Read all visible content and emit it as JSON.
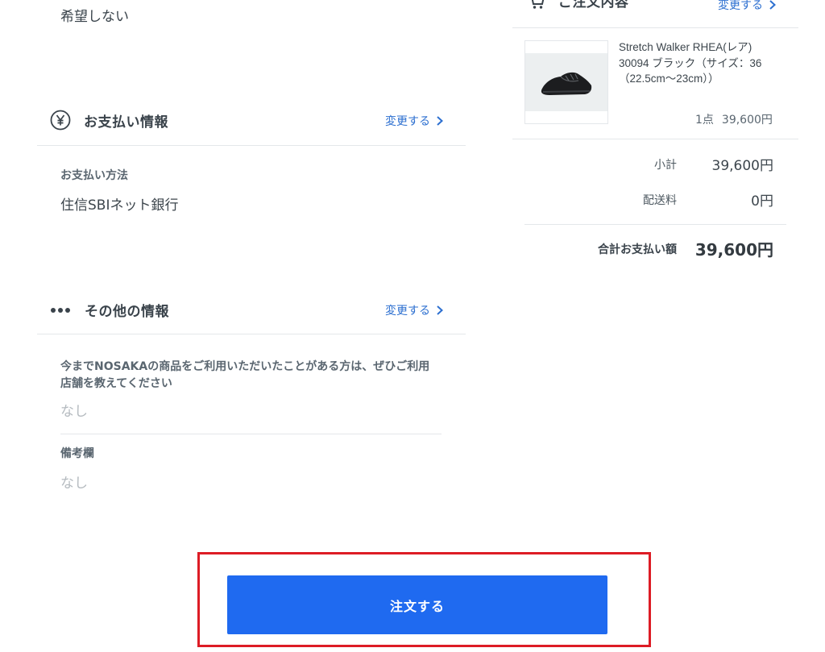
{
  "delivery": {
    "preference_value": "希望しない"
  },
  "payment": {
    "section_title": "お支払い情報",
    "change_label": "変更する",
    "method_label": "お支払い方法",
    "method_value": "住信SBIネット銀行"
  },
  "other": {
    "section_title": "その他の情報",
    "change_label": "変更する",
    "fields": [
      {
        "label": "今までNOSAKAの商品をご利用いただいたことがある方は、ぜひご利用店舗を教えてください",
        "value": "なし"
      },
      {
        "label": "備考欄",
        "value": "なし"
      }
    ]
  },
  "order_summary": {
    "title": "ご注文内容",
    "change_label": "変更する",
    "item": {
      "name": "Stretch Walker RHEA(レア) 30094 ブラック（サイズ：36（22.5cm〜23cm））",
      "quantity": "1点",
      "price": "39,600円",
      "image_icon": "black-sneaker-photo"
    },
    "subtotal_label": "小計",
    "subtotal_value": "39,600円",
    "shipping_label": "配送料",
    "shipping_value": "0円",
    "total_label": "合計お支払い額",
    "total_value": "39,600円"
  },
  "cta": {
    "order_label": "注文する",
    "button_color": "#1f6af0",
    "highlight_color": "#dd1c25"
  },
  "colors": {
    "link": "#2c6fd0",
    "muted": "#b4babf"
  }
}
